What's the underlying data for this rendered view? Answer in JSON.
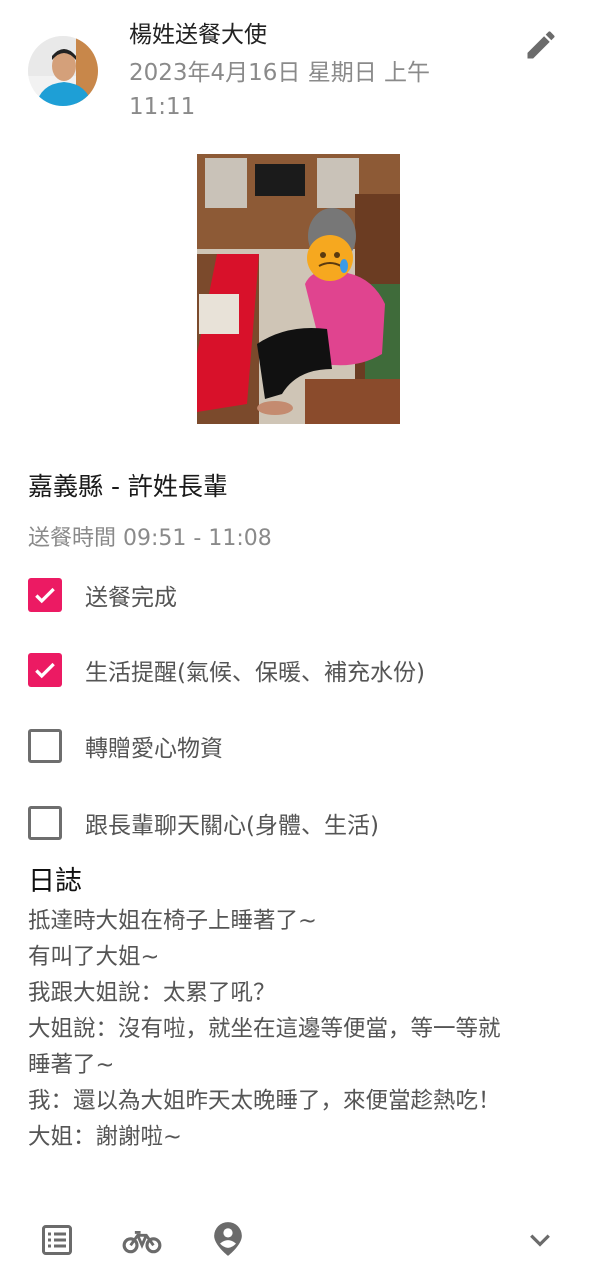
{
  "post": {
    "author": "楊姓送餐大使",
    "datetime": "2023年4月16日 星期日 上午 11:11",
    "avatar_icon": "person-avatar",
    "edit_icon": "pencil-icon"
  },
  "photo": {
    "description_icon": "photo-elderly-woman-seated"
  },
  "recipient": {
    "title": "嘉義縣 - 許姓長輩",
    "delivery_time": "送餐時間 09:51 - 11:08"
  },
  "checklist": [
    {
      "label": "送餐完成",
      "checked": true
    },
    {
      "label": "生活提醒(氣候、保暖、補充水份)",
      "checked": true
    },
    {
      "label": "轉贈愛心物資",
      "checked": false
    },
    {
      "label": "跟長輩聊天關心(身體、生活)",
      "checked": false
    }
  ],
  "log": {
    "title": "日誌",
    "lines": [
      "抵達時大姐在椅子上睡著了~",
      "有叫了大姐~",
      "我跟大姐說：太累了吼？",
      "大姐說：沒有啦，就坐在這邊等便當，等一等就",
      "睡著了~",
      "我：還以為大姐昨天太晚睡了，來便當趁熱吃！",
      "大姐：謝謝啦~"
    ]
  },
  "bottom_nav": {
    "icons": [
      "list-icon",
      "bicycle-icon",
      "person-pin-icon",
      "chevron-down-icon"
    ]
  },
  "colors": {
    "accent": "#ec1a63",
    "muted_text": "#8a8a8a"
  }
}
